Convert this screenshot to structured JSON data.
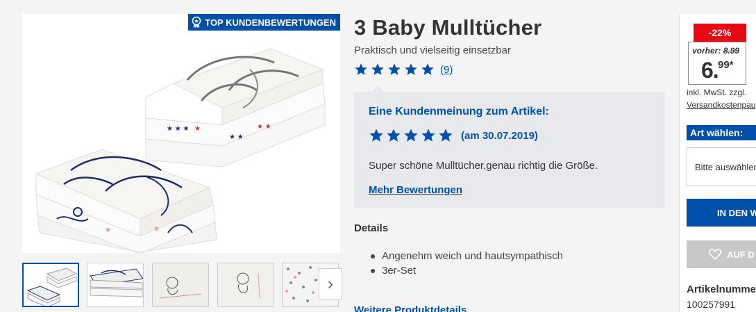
{
  "badge": {
    "text": "TOP KUNDENBEWERTUNGEN",
    "icon": "award-ribbon-icon"
  },
  "product": {
    "title": "3 Baby Mulltücher",
    "subtitle": "Praktisch und vielseitig einsetzbar",
    "rating": 5,
    "rating_count": "(9)"
  },
  "review": {
    "heading": "Eine Kundenmeinung zum Artikel:",
    "rating": 5,
    "date": "(am 30.07.2019)",
    "text": "Super schöne Mulltücher,genau richtig die Größe.",
    "more_link": "Mehr Bewertungen"
  },
  "details": {
    "title": "Details",
    "items": [
      "Angenehm weich und hautsympathisch",
      "3er-Set"
    ],
    "more_link": "Weitere Produktdetails"
  },
  "gallery": {
    "thumbnails": [
      "thumbnail-1",
      "thumbnail-2",
      "thumbnail-3",
      "thumbnail-4",
      "thumbnail-5"
    ],
    "active_index": 0,
    "next_icon": "chevron-right-icon"
  },
  "buybox": {
    "discount": "-22%",
    "old_price_label": "vorher:",
    "old_price": "8.99",
    "price_main": "6.",
    "price_cents": "99*",
    "vat": "inkl. MwSt. zzgl.",
    "shipping": "Versandkostenpau",
    "variant_label": "Art wählen:",
    "variant_placeholder": "Bitte auswählen",
    "cart_button": "IN DEN W",
    "wishlist_button": "AUF D",
    "article_number_label": "Artikelnummer",
    "article_number": "100257991"
  },
  "colors": {
    "brand_blue": "#0050aa",
    "sale_red": "#e60a14",
    "review_bg": "#e7e9ed"
  }
}
